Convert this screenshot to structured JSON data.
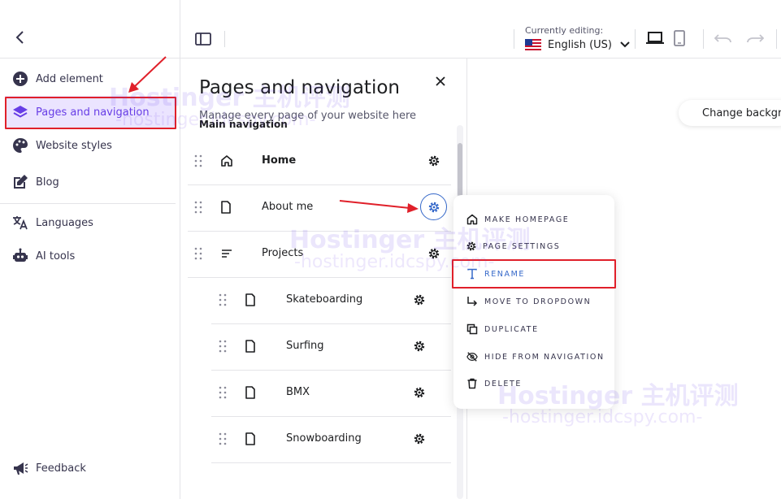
{
  "topbar": {
    "editing_label": "Currently editing:",
    "language": "English (US)"
  },
  "sidebar": {
    "items": [
      {
        "label": "Add element",
        "icon": "plus-circle-icon"
      },
      {
        "label": "Pages and navigation",
        "icon": "layers-icon",
        "active": true
      },
      {
        "label": "Website styles",
        "icon": "palette-icon"
      },
      {
        "label": "Blog",
        "icon": "edit-icon"
      },
      {
        "label": "Languages",
        "icon": "translate-icon"
      },
      {
        "label": "AI tools",
        "icon": "robot-icon"
      }
    ],
    "feedback": "Feedback"
  },
  "panel": {
    "title": "Pages and navigation",
    "subtitle": "Manage every page of your website here",
    "section": "Main navigation",
    "pages": [
      {
        "label": "Home",
        "icon": "home-icon"
      },
      {
        "label": "About me",
        "icon": "page-icon"
      },
      {
        "label": "Projects",
        "icon": "dropdown-icon"
      }
    ],
    "subpages": [
      {
        "label": "Skateboarding"
      },
      {
        "label": "Surfing"
      },
      {
        "label": "BMX"
      },
      {
        "label": "Snowboarding"
      }
    ]
  },
  "menu": {
    "items": [
      {
        "label": "MAKE HOMEPAGE",
        "icon": "home-icon"
      },
      {
        "label": "PAGE SETTINGS",
        "icon": "gear-icon"
      },
      {
        "label": "RENAME",
        "icon": "text-icon"
      },
      {
        "label": "MOVE TO DROPDOWN",
        "icon": "arrow-down-right-icon"
      },
      {
        "label": "DUPLICATE",
        "icon": "copy-icon"
      },
      {
        "label": "HIDE FROM NAVIGATION",
        "icon": "eye-off-icon"
      },
      {
        "label": "DELETE",
        "icon": "trash-icon"
      }
    ]
  },
  "canvas": {
    "change_background": "Change background"
  },
  "watermark": {
    "brand": "Hostinger 主机评测",
    "url": "-hostinger.idcspy.com-"
  },
  "colors": {
    "accent": "#673de6",
    "active_bg": "#ebe4ff",
    "highlight_red": "#e0202a",
    "link_blue": "#3568c9"
  }
}
